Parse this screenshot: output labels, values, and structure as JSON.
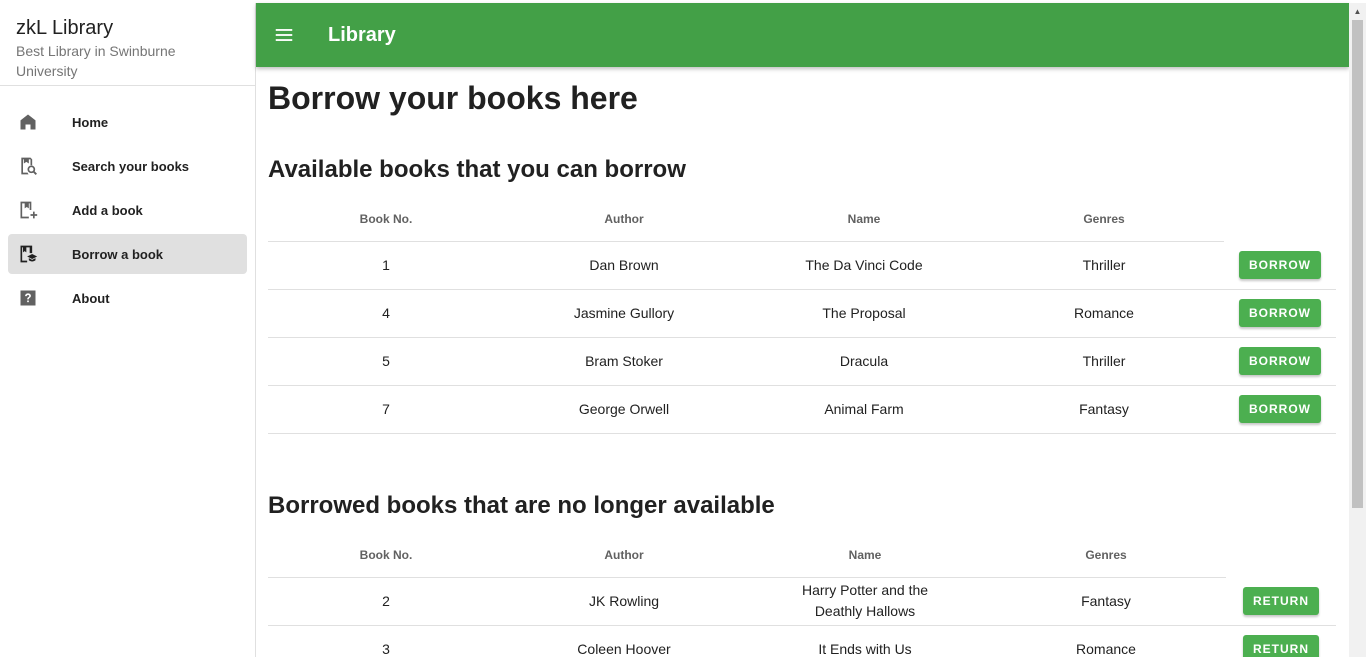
{
  "drawer": {
    "title": "zkL Library",
    "subtitle": "Best Library in Swinburne University",
    "items": [
      {
        "label": "Home",
        "icon": "home-icon"
      },
      {
        "label": "Search your books",
        "icon": "search-book-icon"
      },
      {
        "label": "Add a book",
        "icon": "add-book-icon"
      },
      {
        "label": "Borrow a book",
        "icon": "borrow-book-icon",
        "active": true
      },
      {
        "label": "About",
        "icon": "help-icon"
      }
    ]
  },
  "appbar": {
    "title": "Library",
    "menu_icon": "menu-icon",
    "color": "#43a047"
  },
  "main": {
    "page_title": "Borrow your books here",
    "available": {
      "title": "Available books that you can borrow",
      "headers": [
        "Book No.",
        "Author",
        "Name",
        "Genres"
      ],
      "action_label": "BORROW",
      "rows": [
        {
          "no": "1",
          "author": "Dan Brown",
          "name": "The Da Vinci Code",
          "genre": "Thriller"
        },
        {
          "no": "4",
          "author": "Jasmine Gullory",
          "name": "The Proposal",
          "genre": "Romance"
        },
        {
          "no": "5",
          "author": "Bram Stoker",
          "name": "Dracula",
          "genre": "Thriller"
        },
        {
          "no": "7",
          "author": "George Orwell",
          "name": "Animal Farm",
          "genre": "Fantasy"
        }
      ]
    },
    "borrowed": {
      "title": "Borrowed books that are no longer available",
      "headers": [
        "Book No.",
        "Author",
        "Name",
        "Genres"
      ],
      "action_label": "RETURN",
      "rows": [
        {
          "no": "2",
          "author": "JK Rowling",
          "name": "Harry Potter and the Deathly Hallows",
          "genre": "Fantasy"
        },
        {
          "no": "3",
          "author": "Coleen Hoover",
          "name": "It Ends with Us",
          "genre": "Romance"
        }
      ]
    }
  },
  "colors": {
    "accent": "#4caf50",
    "active_nav_bg": "#e0e0e0"
  }
}
